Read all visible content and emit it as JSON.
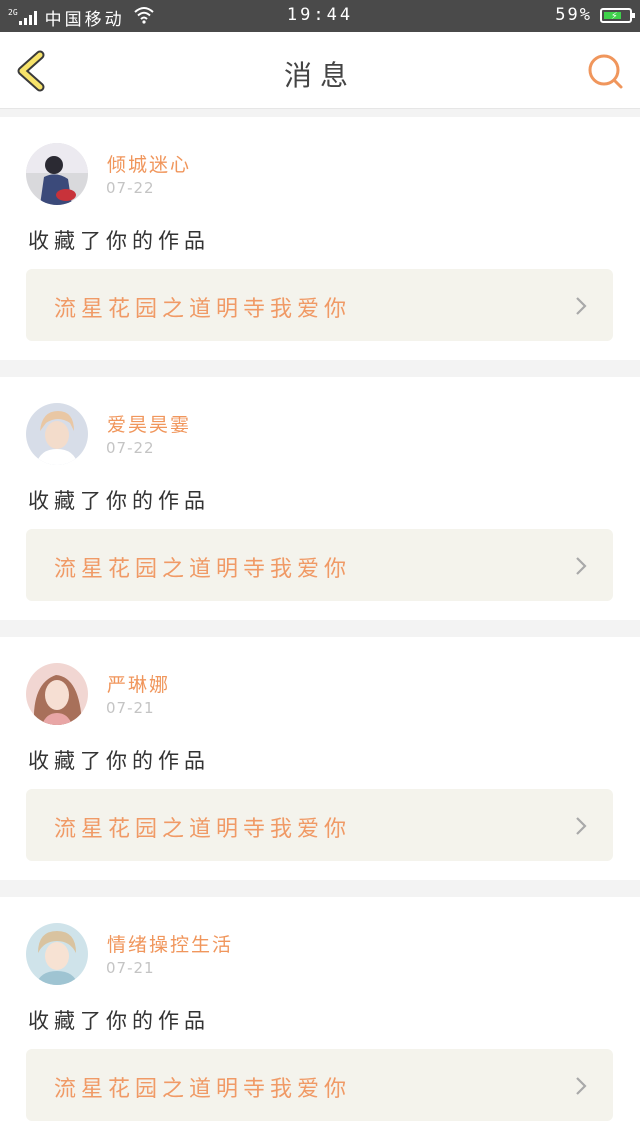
{
  "status_bar": {
    "network": "2G",
    "carrier": "中国移动",
    "time": "19:44",
    "battery": "59%"
  },
  "header": {
    "title": "消息",
    "accent_color": "#f0965c",
    "back_icon": "chevron-left-icon",
    "search_icon": "search-icon"
  },
  "messages": [
    {
      "username": "倾城迷心",
      "date": "07-22",
      "action": "收藏了你的作品",
      "work_title": "流星花园之道明寺我爱你"
    },
    {
      "username": "爱昊昊霎",
      "date": "07-22",
      "action": "收藏了你的作品",
      "work_title": "流星花园之道明寺我爱你"
    },
    {
      "username": "严琳娜",
      "date": "07-21",
      "action": "收藏了你的作品",
      "work_title": "流星花园之道明寺我爱你"
    },
    {
      "username": "情绪操控生活",
      "date": "07-21",
      "action": "收藏了你的作品",
      "work_title": "流星花园之道明寺我爱你"
    }
  ]
}
